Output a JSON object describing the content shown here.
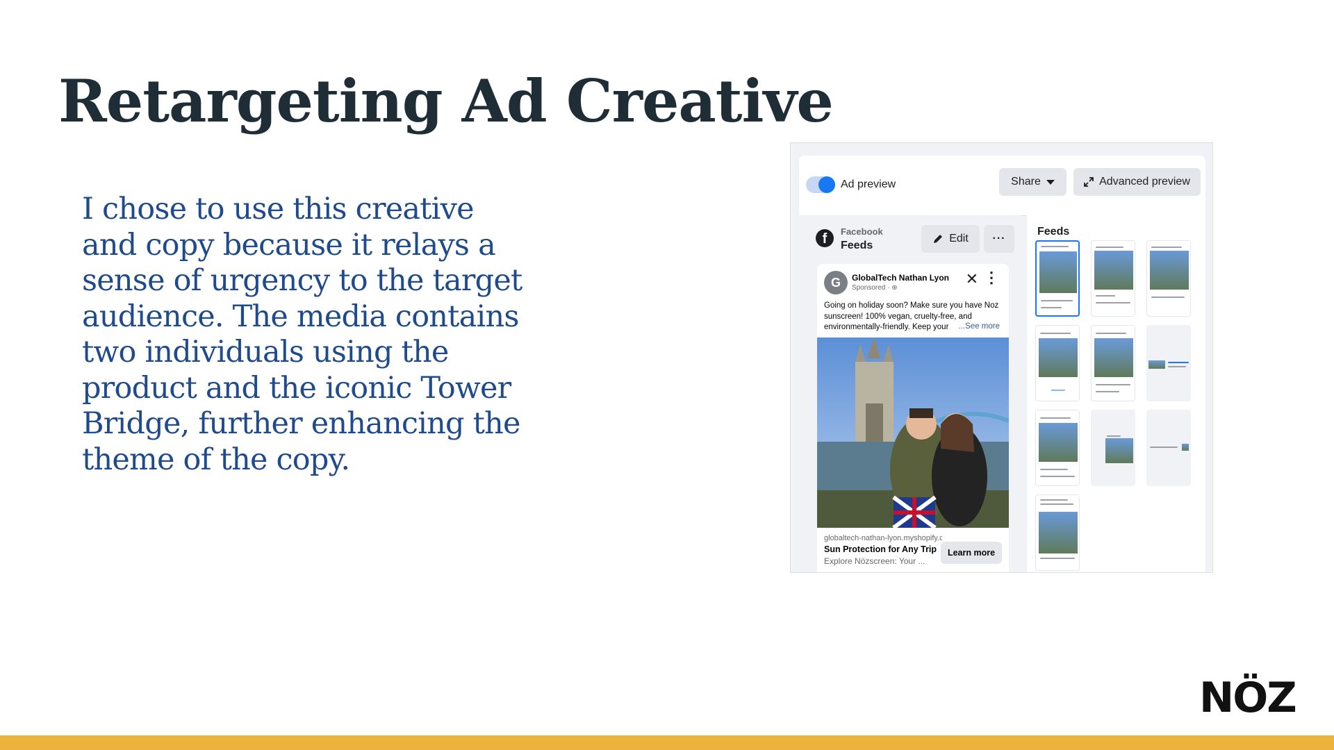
{
  "slide": {
    "title": "Retargeting Ad Creative",
    "body": "I chose to use this creative and copy because it relays a sense of urgency to the target audience. The media contains two individuals using the product and the iconic Tower Bridge, further enhancing the theme of the copy.",
    "brand": "NÖZ"
  },
  "toolbar": {
    "preview_label": "Ad preview",
    "preview_enabled": true,
    "share_label": "Share",
    "advanced_label": "Advanced preview"
  },
  "placement": {
    "platform": "Facebook",
    "position": "Feeds",
    "edit_label": "Edit",
    "more_label": "···",
    "feeds_heading": "Feeds"
  },
  "post": {
    "avatar_letter": "G",
    "page_name": "GlobalTech Nathan Lyon",
    "sponsored": "Sponsored · ",
    "text": "Going on holiday soon? Make sure you have Noz sunscreen! 100% vegan, cruelty-free, and environmentally-friendly. Keep your",
    "see_more": "...See more",
    "link_url": "globaltech-nathan-lyon.myshopify.com",
    "link_title": "Sun Protection for Any Trip",
    "link_desc": "Explore Nözscreen: Your ...",
    "cta_label": "Learn more"
  },
  "colors": {
    "title": "#1f2e36",
    "body_text": "#1f4b8c",
    "accent_bar": "#ebb33b",
    "facebook_blue": "#1877f2"
  },
  "icons": [
    "facebook-icon",
    "pencil-icon",
    "expand-icon",
    "close-icon",
    "kebab-icon",
    "globe-icon"
  ]
}
